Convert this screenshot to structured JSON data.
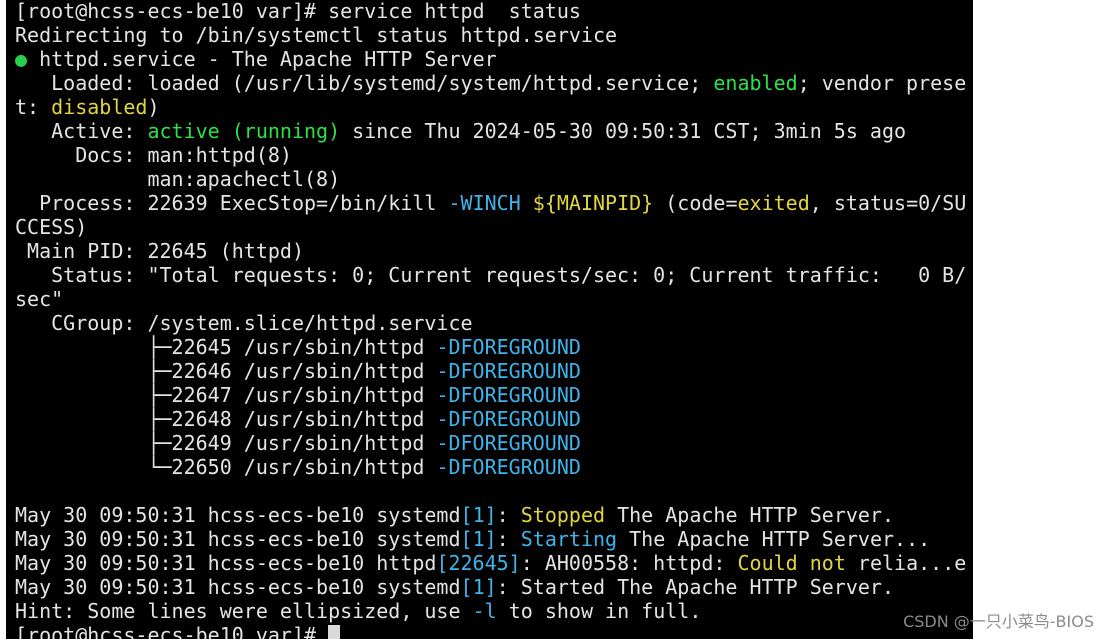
{
  "terminal": {
    "lines": [
      [
        {
          "t": "[root@hcss-ecs-be10 var]# service httpd  status"
        }
      ],
      [
        {
          "t": "Redirecting to /bin/systemctl status httpd.service"
        }
      ],
      [
        {
          "t": "●",
          "c": "bullet"
        },
        {
          "t": " httpd.service - The Apache HTTP Server"
        }
      ],
      [
        {
          "t": "   Loaded: loaded (/usr/lib/systemd/system/httpd.service; "
        },
        {
          "t": "enabled",
          "c": "green"
        },
        {
          "t": "; vendor prese"
        }
      ],
      [
        {
          "t": "t: "
        },
        {
          "t": "disabled",
          "c": "yellow"
        },
        {
          "t": ")"
        }
      ],
      [
        {
          "t": "   Active: "
        },
        {
          "t": "active (running)",
          "c": "green"
        },
        {
          "t": " since Thu 2024-05-30 09:50:31 CST; 3min 5s ago"
        }
      ],
      [
        {
          "t": "     Docs: man:httpd(8)"
        }
      ],
      [
        {
          "t": "           man:apachectl(8)"
        }
      ],
      [
        {
          "t": "  Process: 22639 ExecStop=/bin/kill "
        },
        {
          "t": "-WINCH",
          "c": "cyan"
        },
        {
          "t": " "
        },
        {
          "t": "${MAINPID}",
          "c": "yellow"
        },
        {
          "t": " (code="
        },
        {
          "t": "exited",
          "c": "yellow"
        },
        {
          "t": ", status=0/SU"
        }
      ],
      [
        {
          "t": "CCESS)"
        }
      ],
      [
        {
          "t": " Main PID: 22645 (httpd)"
        }
      ],
      [
        {
          "t": "   Status: \"Total requests: 0; Current requests/sec: 0; Current traffic:   0 B/"
        }
      ],
      [
        {
          "t": "sec\""
        }
      ],
      [
        {
          "t": "   CGroup: /system.slice/httpd.service"
        }
      ],
      [
        {
          "t": "           ├─22645 /usr/sbin/httpd "
        },
        {
          "t": "-DFOREGROUND",
          "c": "cyan"
        }
      ],
      [
        {
          "t": "           ├─22646 /usr/sbin/httpd "
        },
        {
          "t": "-DFOREGROUND",
          "c": "cyan"
        }
      ],
      [
        {
          "t": "           ├─22647 /usr/sbin/httpd "
        },
        {
          "t": "-DFOREGROUND",
          "c": "cyan"
        }
      ],
      [
        {
          "t": "           ├─22648 /usr/sbin/httpd "
        },
        {
          "t": "-DFOREGROUND",
          "c": "cyan"
        }
      ],
      [
        {
          "t": "           ├─22649 /usr/sbin/httpd "
        },
        {
          "t": "-DFOREGROUND",
          "c": "cyan"
        }
      ],
      [
        {
          "t": "           └─22650 /usr/sbin/httpd "
        },
        {
          "t": "-DFOREGROUND",
          "c": "cyan"
        }
      ],
      [
        {
          "t": ""
        }
      ],
      [
        {
          "t": "May 30 09:50:31 hcss-ecs-be10 systemd"
        },
        {
          "t": "[1]",
          "c": "cyan"
        },
        {
          "t": ": "
        },
        {
          "t": "Stopped",
          "c": "yellow"
        },
        {
          "t": " The Apache HTTP Server."
        }
      ],
      [
        {
          "t": "May 30 09:50:31 hcss-ecs-be10 systemd"
        },
        {
          "t": "[1]",
          "c": "cyan"
        },
        {
          "t": ": "
        },
        {
          "t": "Starting",
          "c": "cyan"
        },
        {
          "t": " The Apache HTTP Server..."
        }
      ],
      [
        {
          "t": "May 30 09:50:31 hcss-ecs-be10 httpd"
        },
        {
          "t": "[22645]",
          "c": "cyan"
        },
        {
          "t": ": AH00558: httpd: "
        },
        {
          "t": "Could not",
          "c": "yellow"
        },
        {
          "t": " relia...e"
        }
      ],
      [
        {
          "t": "May 30 09:50:31 hcss-ecs-be10 systemd"
        },
        {
          "t": "[1]",
          "c": "cyan"
        },
        {
          "t": ": Started The Apache HTTP Server."
        }
      ],
      [
        {
          "t": "Hint: Some lines were ellipsized, use "
        },
        {
          "t": "-l",
          "c": "cyan"
        },
        {
          "t": " to show in full."
        }
      ],
      [
        {
          "t": "[root@hcss-ecs-be10 var]# "
        }
      ]
    ],
    "cursor_line": 26
  },
  "colors": {
    "background": "#000000",
    "foreground": "#e4e4e4",
    "green": "#2fe04a",
    "yellow": "#e2d53f",
    "cyan": "#3fb4ea"
  },
  "watermark": "CSDN @一只小菜鸟-BIOS"
}
